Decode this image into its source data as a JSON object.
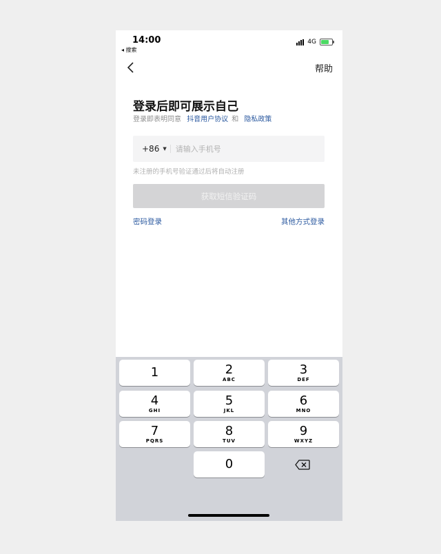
{
  "status_bar": {
    "time": "14:00",
    "back_app": "◂ 搜索",
    "network": "4G",
    "battery_level": 0.75
  },
  "nav": {
    "help_label": "帮助"
  },
  "login": {
    "title": "登录后即可展示自己",
    "agree_prefix": "登录即表明同意",
    "user_agreement": "抖音用户协议",
    "and": "和",
    "privacy_policy": "隐私政策",
    "country_code": "+86",
    "phone_placeholder": "请输入手机号",
    "hint": "未注册的手机号验证通过后将自动注册",
    "sms_button": "获取短信验证码",
    "password_login": "密码登录",
    "other_login": "其他方式登录"
  },
  "keypad": {
    "keys": [
      {
        "num": "1",
        "letters": ""
      },
      {
        "num": "2",
        "letters": "ABC"
      },
      {
        "num": "3",
        "letters": "DEF"
      },
      {
        "num": "4",
        "letters": "GHI"
      },
      {
        "num": "5",
        "letters": "JKL"
      },
      {
        "num": "6",
        "letters": "MNO"
      },
      {
        "num": "7",
        "letters": "PQRS"
      },
      {
        "num": "8",
        "letters": "TUV"
      },
      {
        "num": "9",
        "letters": "WXYZ"
      },
      {
        "num": "0",
        "letters": ""
      }
    ]
  }
}
